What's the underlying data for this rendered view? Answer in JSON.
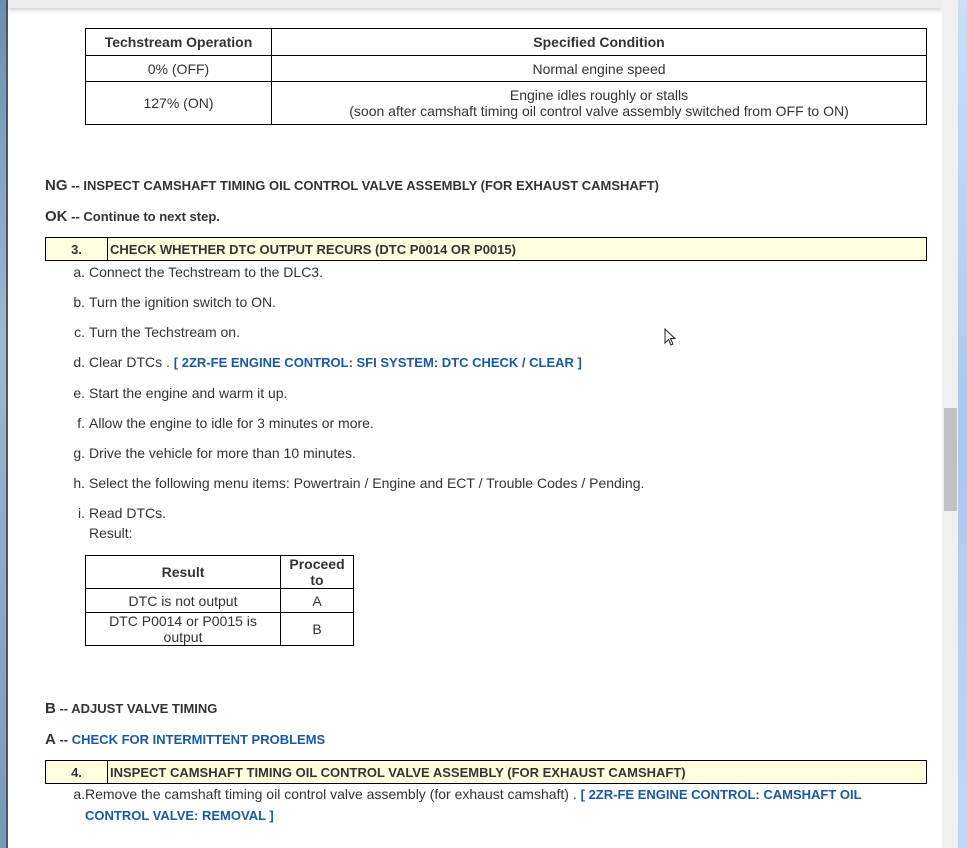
{
  "table1": {
    "headers": [
      "Techstream Operation",
      "Specified Condition"
    ],
    "rows": [
      [
        "0% (OFF)",
        "Normal engine speed"
      ],
      [
        "127% (ON)",
        "Engine idles roughly or stalls",
        "(soon after camshaft timing oil control valve assembly switched from OFF to ON)"
      ]
    ]
  },
  "ng": {
    "key": "NG",
    "sep": " -- ",
    "text": "INSPECT CAMSHAFT TIMING OIL CONTROL VALVE ASSEMBLY (FOR EXHAUST CAMSHAFT)"
  },
  "ok": {
    "key": "OK",
    "sep": " -- ",
    "text": "Continue to next step."
  },
  "step3": {
    "num": "3.",
    "title": "CHECK WHETHER DTC OUTPUT RECURS (DTC P0014 OR P0015)",
    "items": [
      {
        "m": "a.",
        "t": "Connect the Techstream to the DLC3."
      },
      {
        "m": "b.",
        "t": "Turn the ignition switch to ON."
      },
      {
        "m": "c.",
        "t": "Turn the Techstream on."
      },
      {
        "m": "d.",
        "t": "Clear DTCs . ",
        "link": "[ 2ZR-FE ENGINE CONTROL: SFI SYSTEM: DTC CHECK / CLEAR ]"
      },
      {
        "m": "e.",
        "t": "Start the engine and warm it up."
      },
      {
        "m": "f.",
        "t": "Allow the engine to idle for 3 minutes or more."
      },
      {
        "m": "g.",
        "t": "Drive the vehicle for more than 10 minutes."
      },
      {
        "m": "h.",
        "t": "Select the following menu items: Powertrain / Engine and ECT / Trouble Codes / Pending."
      },
      {
        "m": "i.",
        "t": "Read DTCs.",
        "t2": "Result:"
      }
    ]
  },
  "result_table": {
    "headers": [
      "Result",
      "Proceed to"
    ],
    "rows": [
      [
        "DTC is not output",
        "A"
      ],
      [
        "DTC P0014 or P0015 is output",
        "B"
      ]
    ]
  },
  "b": {
    "key": "B",
    "sep": " -- ",
    "text": "ADJUST VALVE TIMING"
  },
  "a": {
    "key": "A",
    "sep": " -- ",
    "text": "CHECK FOR INTERMITTENT PROBLEMS"
  },
  "step4": {
    "num": "4.",
    "title": "INSPECT CAMSHAFT TIMING OIL CONTROL VALVE ASSEMBLY (FOR EXHAUST CAMSHAFT)",
    "item": {
      "m": "a.",
      "t": "Remove the camshaft timing oil control valve assembly (for exhaust camshaft) . ",
      "link1": "[ 2ZR-FE ENGINE CONTROL: CAMSHAFT OIL",
      "link2": "CONTROL VALVE: REMOVAL ]"
    }
  }
}
